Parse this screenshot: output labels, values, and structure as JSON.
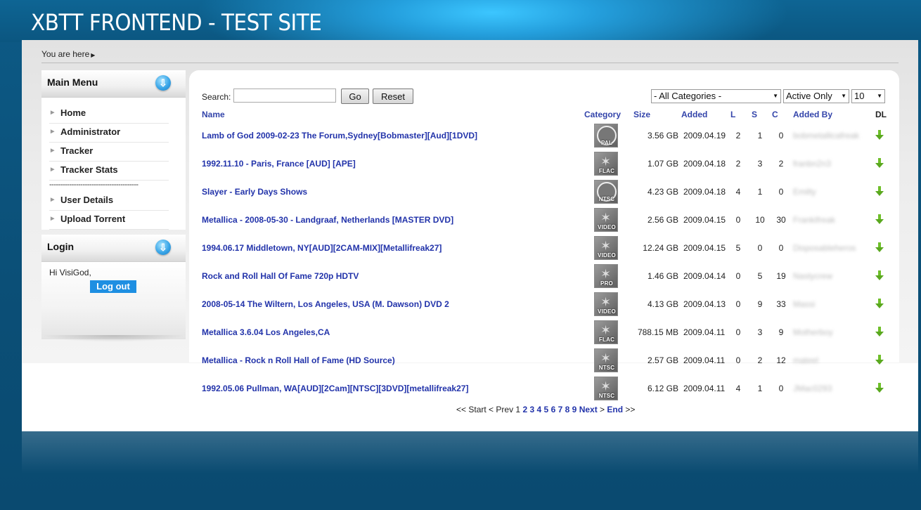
{
  "site_title": "XBTT FRONTEND - TEST SITE",
  "breadcrumb": "You are here",
  "main_menu": {
    "title": "Main Menu",
    "items": [
      "Home",
      "Administrator",
      "Tracker",
      "Tracker Stats"
    ],
    "separator": "----------------------------------------",
    "items2": [
      "User Details",
      "Upload Torrent"
    ]
  },
  "login": {
    "title": "Login",
    "greeting": "Hi VisiGod,",
    "logout_label": "Log out"
  },
  "search": {
    "label": "Search:",
    "value": "",
    "go_label": "Go",
    "reset_label": "Reset"
  },
  "filters": {
    "category": "- All Categories -",
    "status": "Active Only",
    "limit": "10"
  },
  "columns": {
    "name": "Name",
    "category": "Category",
    "size": "Size",
    "added": "Added",
    "l": "L",
    "s": "S",
    "c": "C",
    "added_by": "Added By",
    "dl": "DL"
  },
  "torrents": [
    {
      "name": "Lamb of God 2009-02-23 The Forum,Sydney[Bobmaster][Aud][1DVD]",
      "category": "PAL",
      "size": "3.56 GB",
      "added": "2009.04.19",
      "l": "2",
      "s": "1",
      "c": "0",
      "added_by": "bobmetallicafreak"
    },
    {
      "name": "1992.11.10 - Paris, France [AUD] [APE]",
      "category": "FLAC",
      "size": "1.07 GB",
      "added": "2009.04.18",
      "l": "2",
      "s": "3",
      "c": "2",
      "added_by": "franbn2n3"
    },
    {
      "name": "Slayer - Early Days Shows",
      "category": "NTSC",
      "size": "4.23 GB",
      "added": "2009.04.18",
      "l": "4",
      "s": "1",
      "c": "0",
      "added_by": "Emilty"
    },
    {
      "name": "Metallica - 2008-05-30 - Landgraaf, Netherlands [MASTER DVD]",
      "category": "VIDEO",
      "size": "2.56 GB",
      "added": "2009.04.15",
      "l": "0",
      "s": "10",
      "c": "30",
      "added_by": "Frankifreak"
    },
    {
      "name": "1994.06.17 Middletown, NY[AUD][2CAM-MIX][Metallifreak27]",
      "category": "VIDEO",
      "size": "12.24 GB",
      "added": "2009.04.15",
      "l": "5",
      "s": "0",
      "c": "0",
      "added_by": "Disposableheros"
    },
    {
      "name": "Rock and Roll Hall Of Fame 720p HDTV",
      "category": "PRO",
      "size": "1.46 GB",
      "added": "2009.04.14",
      "l": "0",
      "s": "5",
      "c": "19",
      "added_by": "Nastycrew"
    },
    {
      "name": "2008-05-14 The Wiltern, Los Angeles, USA (M. Dawson) DVD 2",
      "category": "VIDEO",
      "size": "4.13 GB",
      "added": "2009.04.13",
      "l": "0",
      "s": "9",
      "c": "33",
      "added_by": "Massi"
    },
    {
      "name": "Metallica 3.6.04 Los Angeles,CA",
      "category": "FLAC",
      "size": "788.15 MB",
      "added": "2009.04.11",
      "l": "0",
      "s": "3",
      "c": "9",
      "added_by": "Motherboy"
    },
    {
      "name": "Metallica - Rock n Roll Hall of Fame (HD Source)",
      "category": "NTSC",
      "size": "2.57 GB",
      "added": "2009.04.11",
      "l": "0",
      "s": "2",
      "c": "12",
      "added_by": "mateel"
    },
    {
      "name": "1992.05.06 Pullman, WA[AUD][2Cam][NTSC][3DVD][metallifreak27]",
      "category": "NTSC",
      "size": "6.12 GB",
      "added": "2009.04.11",
      "l": "4",
      "s": "1",
      "c": "0",
      "added_by": "JMac0293"
    }
  ],
  "pagination": {
    "start": "<< Start",
    "prev": "< Prev",
    "current": "1",
    "pages": [
      "2",
      "3",
      "4",
      "5",
      "6",
      "7",
      "8",
      "9"
    ],
    "next": "Next",
    "next_suffix": ">",
    "end": "End",
    "end_suffix": ">>"
  },
  "colors": {
    "background": "#0b4f77",
    "banner_glow": "#3cc6ff",
    "link": "#2233aa",
    "button_blue": "#1e8fe2",
    "download_green": "#6fbf2a"
  },
  "icons": {
    "module_toggle": "down-arrow-circle-icon",
    "download": "download-arrow-icon",
    "menu_bullet": "triangle-right-icon"
  }
}
